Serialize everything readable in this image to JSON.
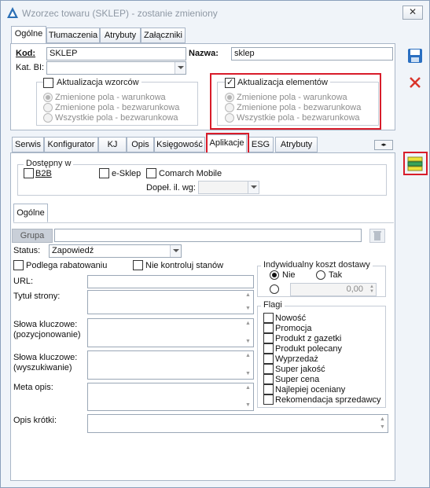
{
  "window": {
    "title": "Wzorzec towaru (SKLEP) - zostanie zmieniony",
    "close_label": "✕"
  },
  "top_tabs": [
    "Ogólne",
    "Tłumaczenia",
    "Atrybuty",
    "Załączniki"
  ],
  "general": {
    "kod_label": "Kod:",
    "kod_value": "SKLEP",
    "nazwa_label": "Nazwa:",
    "nazwa_value": "sklep",
    "katbi_label": "Kat. BI:",
    "katbi_value": ""
  },
  "template_update": {
    "title": "Aktualizacja wzorców",
    "checked": false,
    "options": [
      "Zmienione pola - warunkowa",
      "Zmienione pola - bezwarunkowa",
      "Wszystkie pola - bezwarunkowa"
    ],
    "selected": 0
  },
  "element_update": {
    "title": "Aktualizacja elementów",
    "checked": true,
    "options": [
      "Zmienione pola - warunkowa",
      "Zmienione pola - bezwarunkowa",
      "Wszystkie pola - bezwarunkowa"
    ],
    "selected": 0
  },
  "sub_tabs": [
    "Serwis",
    "Konfigurator",
    "KJ",
    "Opis",
    "Księgowość",
    "Aplikacje",
    "ESG",
    "Atrybuty"
  ],
  "active_sub_tab": "Aplikacje",
  "available": {
    "title": "Dostępny w",
    "b2b_label": "B2B",
    "esklep_label": "e-Sklep",
    "comarch_mobile_label": "Comarch Mobile",
    "dopel_label": "Dopeł. il. wg:",
    "dopel_value": ""
  },
  "inner_tab": "Ogólne",
  "grupa": {
    "button_label": "Grupa",
    "value": ""
  },
  "status": {
    "label": "Status:",
    "value": "Zapowiedź"
  },
  "checks": {
    "podlega_label": "Podlega rabatowaniu",
    "nie_kontroluj_label": "Nie kontroluj stanów"
  },
  "shipping": {
    "title": "Indywidualny koszt dostawy",
    "nie_label": "Nie",
    "tak_label": "Tak",
    "selected": "Nie",
    "amount": "0,00"
  },
  "fields": {
    "url_label": "URL:",
    "tytul_label": "Tytuł strony:",
    "slowa_poz_label_1": "Słowa kluczowe:",
    "slowa_poz_label_2": "(pozycjonowanie)",
    "slowa_wysz_label_1": "Słowa kluczowe:",
    "slowa_wysz_label_2": "(wyszukiwanie)",
    "meta_label": "Meta opis:",
    "opis_label": "Opis krótki:"
  },
  "flags": {
    "title": "Flagi",
    "items": [
      "Nowość",
      "Promocja",
      "Produkt z gazetki",
      "Produkt polecany",
      "Wyprzedaż",
      "Super jakość",
      "Super cena",
      "Najlepiej oceniany",
      "Rekomendacja sprzedawcy"
    ]
  },
  "side_buttons": [
    "save-icon",
    "delete-icon",
    "list-icon"
  ],
  "colors": {
    "highlight": "#d81c2a",
    "border": "#a9b6c7",
    "window_bg": "#f0f4f9"
  }
}
